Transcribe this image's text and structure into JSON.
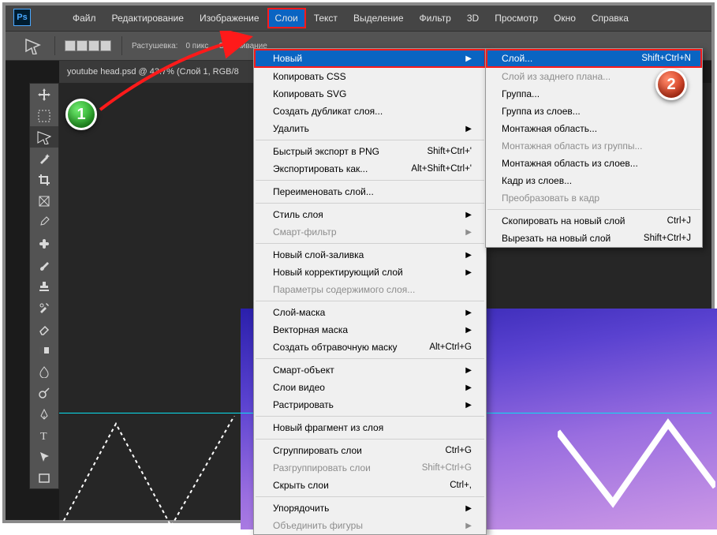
{
  "app": {
    "logo": "Ps"
  },
  "menubar": {
    "items": [
      "Файл",
      "Редактирование",
      "Изображение",
      "Слои",
      "Текст",
      "Выделение",
      "Фильтр",
      "3D",
      "Просмотр",
      "Окно",
      "Справка"
    ]
  },
  "optbar": {
    "label1": "Растушевка:",
    "val1": "0 пикс.",
    "label2": "Сглаживание"
  },
  "tab": {
    "title": "youtube head.psd @ 43.7% (Слой 1, RGB/8"
  },
  "tools": [
    "move",
    "rect-select",
    "lasso",
    "wand",
    "crop",
    "frame",
    "eyedropper",
    "heal",
    "brush",
    "stamp",
    "history",
    "eraser",
    "gradient",
    "blur",
    "dodge",
    "pen",
    "type",
    "path",
    "shape"
  ],
  "dropdown": {
    "sections": [
      [
        {
          "label": "Новый",
          "sub": true,
          "hi": true
        },
        {
          "label": "Копировать CSS"
        },
        {
          "label": "Копировать SVG"
        },
        {
          "label": "Создать дубликат слоя..."
        },
        {
          "label": "Удалить",
          "sub": true
        }
      ],
      [
        {
          "label": "Быстрый экспорт в PNG",
          "short": "Shift+Ctrl+'"
        },
        {
          "label": "Экспортировать как...",
          "short": "Alt+Shift+Ctrl+'"
        }
      ],
      [
        {
          "label": "Переименовать слой..."
        }
      ],
      [
        {
          "label": "Стиль слоя",
          "sub": true
        },
        {
          "label": "Смарт-фильтр",
          "sub": true,
          "disabled": true
        }
      ],
      [
        {
          "label": "Новый слой-заливка",
          "sub": true
        },
        {
          "label": "Новый корректирующий слой",
          "sub": true
        },
        {
          "label": "Параметры содержимого слоя...",
          "disabled": true
        }
      ],
      [
        {
          "label": "Слой-маска",
          "sub": true
        },
        {
          "label": "Векторная маска",
          "sub": true
        },
        {
          "label": "Создать обтравочную маску",
          "short": "Alt+Ctrl+G"
        }
      ],
      [
        {
          "label": "Смарт-объект",
          "sub": true
        },
        {
          "label": "Слои видео",
          "sub": true
        },
        {
          "label": "Растрировать",
          "sub": true
        }
      ],
      [
        {
          "label": "Новый фрагмент из слоя"
        }
      ],
      [
        {
          "label": "Сгруппировать слои",
          "short": "Ctrl+G"
        },
        {
          "label": "Разгруппировать слои",
          "short": "Shift+Ctrl+G",
          "disabled": true
        },
        {
          "label": "Скрыть слои",
          "short": "Ctrl+,"
        }
      ],
      [
        {
          "label": "Упорядочить",
          "sub": true
        },
        {
          "label": "Объединить фигуры",
          "sub": true,
          "disabled": true
        }
      ]
    ]
  },
  "submenu": {
    "sections": [
      [
        {
          "label": "Слой...",
          "short": "Shift+Ctrl+N",
          "hi": true
        },
        {
          "label": "Слой из заднего плана...",
          "disabled": true
        },
        {
          "label": "Группа..."
        },
        {
          "label": "Группа из слоев..."
        },
        {
          "label": "Монтажная область..."
        },
        {
          "label": "Монтажная область из группы...",
          "disabled": true
        },
        {
          "label": "Монтажная область из слоев..."
        },
        {
          "label": "Кадр из слоев..."
        },
        {
          "label": "Преобразовать в кадр",
          "disabled": true
        }
      ],
      [
        {
          "label": "Скопировать на новый слой",
          "short": "Ctrl+J"
        },
        {
          "label": "Вырезать на новый слой",
          "short": "Shift+Ctrl+J"
        }
      ]
    ]
  },
  "markers": {
    "m1": "1",
    "m2": "2"
  }
}
